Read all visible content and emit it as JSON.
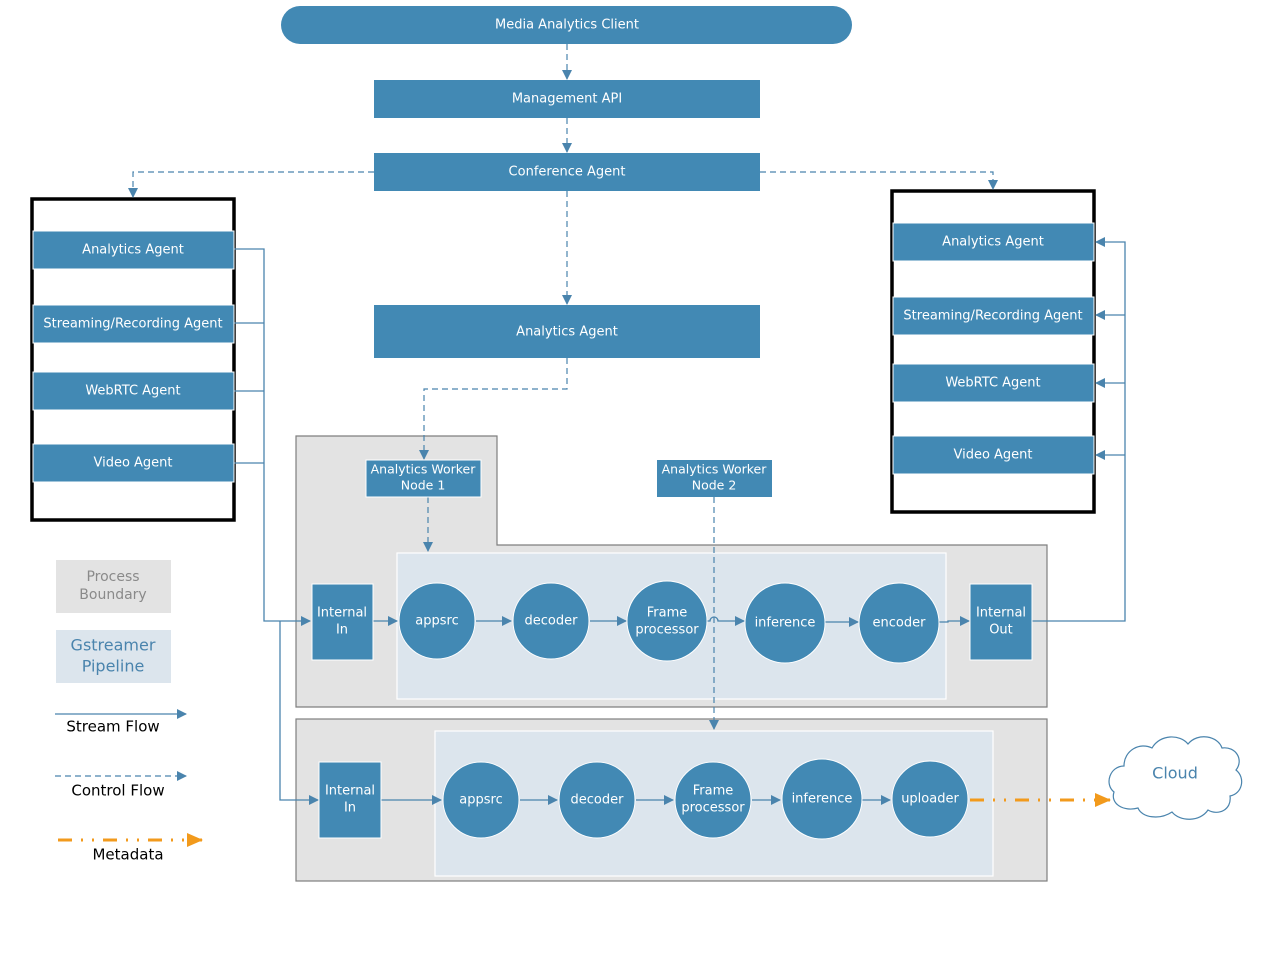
{
  "colors": {
    "node": "#4289b4",
    "process_boundary": "#e3e3e3",
    "process_boundary_border": "#7f7f7f",
    "pipeline": "#dce5ed",
    "stream_line": "#4a84ad",
    "metadata": "#f29a1c",
    "legend_process_text": "#8a8a8a",
    "legend_pipeline_text": "#4a84ad",
    "cloud_text": "#4a84ad"
  },
  "top": {
    "client": "Media Analytics Client",
    "management_api": "Management API",
    "conference_agent": "Conference Agent",
    "analytics_agent": "Analytics Agent"
  },
  "left_group": {
    "items": [
      "Analytics Agent",
      "Streaming/Recording Agent",
      "WebRTC Agent",
      "Video Agent"
    ]
  },
  "right_group": {
    "items": [
      "Analytics Agent",
      "Streaming/Recording Agent",
      "WebRTC Agent",
      "Video Agent"
    ]
  },
  "workers": {
    "node1": [
      "Analytics Worker",
      "Node 1"
    ],
    "node2": [
      "Analytics Worker",
      "Node 2"
    ]
  },
  "pipeline1": {
    "input": [
      "Internal",
      "In"
    ],
    "stages": [
      [
        "appsrc"
      ],
      [
        "decoder"
      ],
      [
        "Frame",
        "processor"
      ],
      [
        "inference"
      ],
      [
        "encoder"
      ]
    ],
    "output": [
      "Internal",
      "Out"
    ]
  },
  "pipeline2": {
    "input": [
      "Internal",
      "In"
    ],
    "stages": [
      [
        "appsrc"
      ],
      [
        "decoder"
      ],
      [
        "Frame",
        "processor"
      ],
      [
        "inference"
      ],
      [
        "uploader"
      ]
    ]
  },
  "cloud": "Cloud",
  "legend": {
    "process_boundary": [
      "Process",
      "Boundary"
    ],
    "gstreamer_pipeline": [
      "Gstreamer",
      "Pipeline"
    ],
    "stream_flow": "Stream Flow",
    "control_flow": "Control Flow",
    "metadata": "Metadata"
  }
}
